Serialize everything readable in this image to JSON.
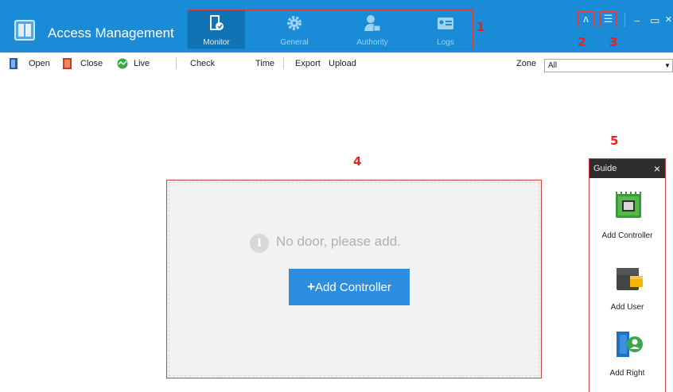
{
  "app": {
    "title": "Access Management"
  },
  "modules": [
    {
      "label": "Monitor",
      "icon": "monitor-door-icon",
      "active": true
    },
    {
      "label": "General",
      "icon": "gear-icon",
      "active": false
    },
    {
      "label": "Authority",
      "icon": "user-lock-icon",
      "active": false
    },
    {
      "label": "Logs",
      "icon": "log-card-icon",
      "active": false
    }
  ],
  "annotations": [
    "1",
    "2",
    "3",
    "4",
    "5"
  ],
  "window": {
    "help_icon": "ᴧ",
    "menu_icon": "☰",
    "minimize": "–",
    "maximize": "▭",
    "close": "×"
  },
  "toolbar": {
    "open": "Open",
    "close": "Close",
    "live": "Live",
    "check": "Check",
    "time": "Time",
    "export": "Export",
    "upload": "Upload",
    "zone_label": "Zone",
    "zone_value": "All"
  },
  "main": {
    "info_glyph": "i",
    "empty_message": "No door, please add.",
    "add_controller": "Add Controller"
  },
  "guide": {
    "title": "Guide",
    "close": "×",
    "items": [
      {
        "label": "Add Controller",
        "icon": "controller-chip-icon"
      },
      {
        "label": "Add User",
        "icon": "user-card-icon"
      },
      {
        "label": "Add Right",
        "icon": "door-right-icon"
      }
    ]
  },
  "colors": {
    "titlebar": "#1a8bd6",
    "active_module": "#1172b4",
    "button": "#2d8ee0",
    "annotation_red": "#e8221c"
  }
}
